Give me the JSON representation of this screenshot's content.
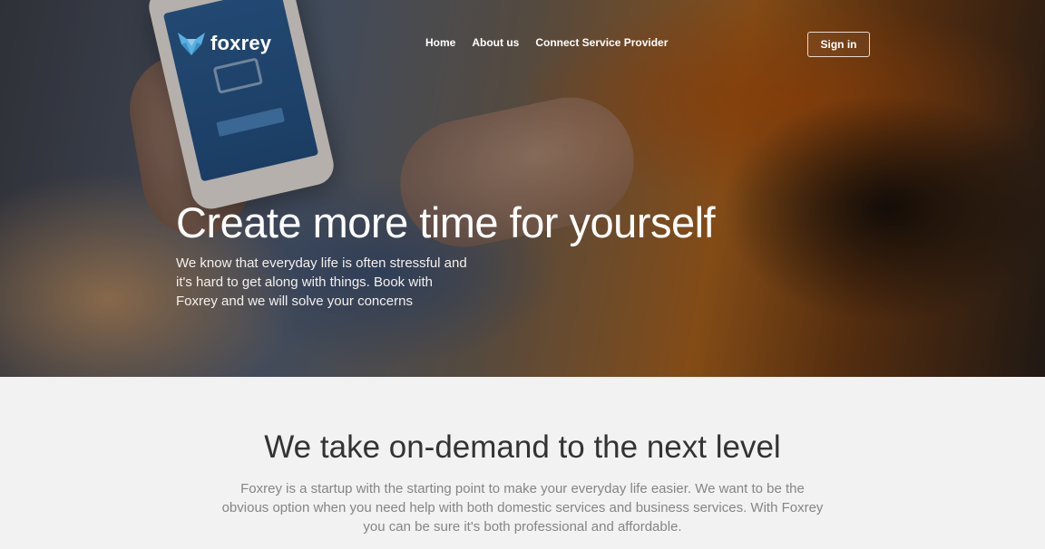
{
  "brand": {
    "name": "foxrey",
    "logo_icon": "fox-icon",
    "accent_color": "#5aaee0"
  },
  "nav": {
    "items": [
      {
        "label": "Home"
      },
      {
        "label": "About us"
      },
      {
        "label": "Connect Service Provider"
      }
    ],
    "signin_label": "Sign in"
  },
  "hero": {
    "title": "Create more time for yourself",
    "subtitle": "We know that everyday life is often stressful and it's hard to get along with things. Book with Foxrey and we will solve your concerns"
  },
  "about": {
    "title": "We take on-demand to the next level",
    "text": "Foxrey is a startup with the starting point to make your everyday life easier. We want to be the obvious option when you need help with both domestic services and business services. With Foxrey you can be sure it's both professional and affordable."
  }
}
